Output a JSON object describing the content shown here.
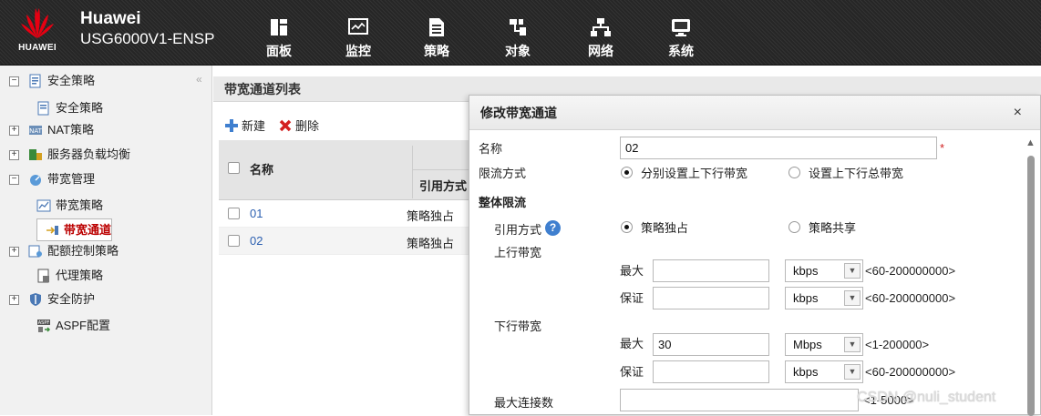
{
  "header": {
    "logo_text": "HUAWEI",
    "brand": "Huawei",
    "model": "USG6000V1-ENSP",
    "nav": [
      {
        "label": "面板",
        "icon": "panel-icon"
      },
      {
        "label": "监控",
        "icon": "monitor-icon"
      },
      {
        "label": "策略",
        "icon": "policy-icon"
      },
      {
        "label": "对象",
        "icon": "object-icon"
      },
      {
        "label": "网络",
        "icon": "network-icon"
      },
      {
        "label": "系统",
        "icon": "system-icon"
      }
    ]
  },
  "sidebar": {
    "collapse": "«",
    "items": [
      {
        "label": "安全策略",
        "expand": "−"
      },
      {
        "label": "安全策略"
      },
      {
        "label": "NAT策略",
        "expand": "+"
      },
      {
        "label": "服务器负载均衡",
        "expand": "+"
      },
      {
        "label": "带宽管理",
        "expand": "−"
      },
      {
        "label": "带宽策略"
      },
      {
        "label": "带宽通道",
        "selected": true
      },
      {
        "label": "配额控制策略",
        "expand": "+"
      },
      {
        "label": "代理策略"
      },
      {
        "label": "安全防护",
        "expand": "+"
      },
      {
        "label": "ASPF配置"
      }
    ]
  },
  "main": {
    "title": "带宽通道列表",
    "new_label": "新建",
    "delete_label": "删除",
    "col_name": "名称",
    "col_ref": "引用方式",
    "rows": [
      {
        "name": "01",
        "ref": "策略独占"
      },
      {
        "name": "02",
        "ref": "策略独占"
      }
    ]
  },
  "dialog": {
    "title": "修改带宽通道",
    "close": "×",
    "name_label": "名称",
    "name_value": "02",
    "required_mark": "*",
    "limit_label": "限流方式",
    "limit_opt1": "分别设置上下行带宽",
    "limit_opt2": "设置上下行总带宽",
    "section": "整体限流",
    "ref_label": "引用方式",
    "help": "?",
    "ref_opt1": "策略独占",
    "ref_opt2": "策略共享",
    "up_label": "上行带宽",
    "down_label": "下行带宽",
    "max_label": "最大",
    "guar_label": "保证",
    "up_max": {
      "value": "",
      "unit": "kbps",
      "range": "<60-200000000>"
    },
    "up_guar": {
      "value": "",
      "unit": "kbps",
      "range": "<60-200000000>"
    },
    "down_max": {
      "value": "30",
      "unit": "Mbps",
      "range": "<1-200000>"
    },
    "down_guar": {
      "value": "",
      "unit": "kbps",
      "range": "<60-200000000>"
    },
    "maxconn_label": "最大连接数",
    "maxconn_value": "",
    "maxconn_range": "<1-5000>"
  },
  "watermark": "CSDN @nuli_student"
}
